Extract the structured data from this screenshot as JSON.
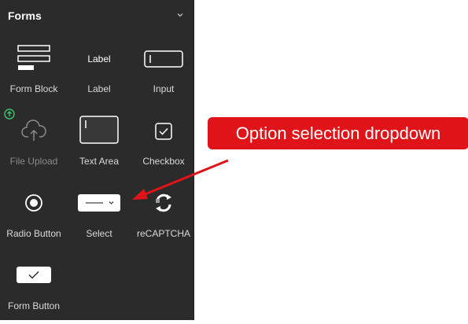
{
  "panel": {
    "title": "Forms",
    "items": [
      {
        "label": "Form Block",
        "icon": "form-block-icon"
      },
      {
        "label": "Label",
        "icon": "label-icon",
        "icon_text": "Label"
      },
      {
        "label": "Input",
        "icon": "input-icon"
      },
      {
        "label": "File Upload",
        "icon": "cloud-upload-icon",
        "disabled": true
      },
      {
        "label": "Text Area",
        "icon": "text-area-icon"
      },
      {
        "label": "Checkbox",
        "icon": "checkbox-icon"
      },
      {
        "label": "Radio Button",
        "icon": "radio-button-icon"
      },
      {
        "label": "Select",
        "icon": "select-dropdown-icon"
      },
      {
        "label": "reCAPTCHA",
        "icon": "recaptcha-icon"
      },
      {
        "label": "Form Button",
        "icon": "form-button-icon"
      }
    ]
  },
  "annotation": {
    "text": "Option selection dropdown",
    "color": "#e01418"
  }
}
